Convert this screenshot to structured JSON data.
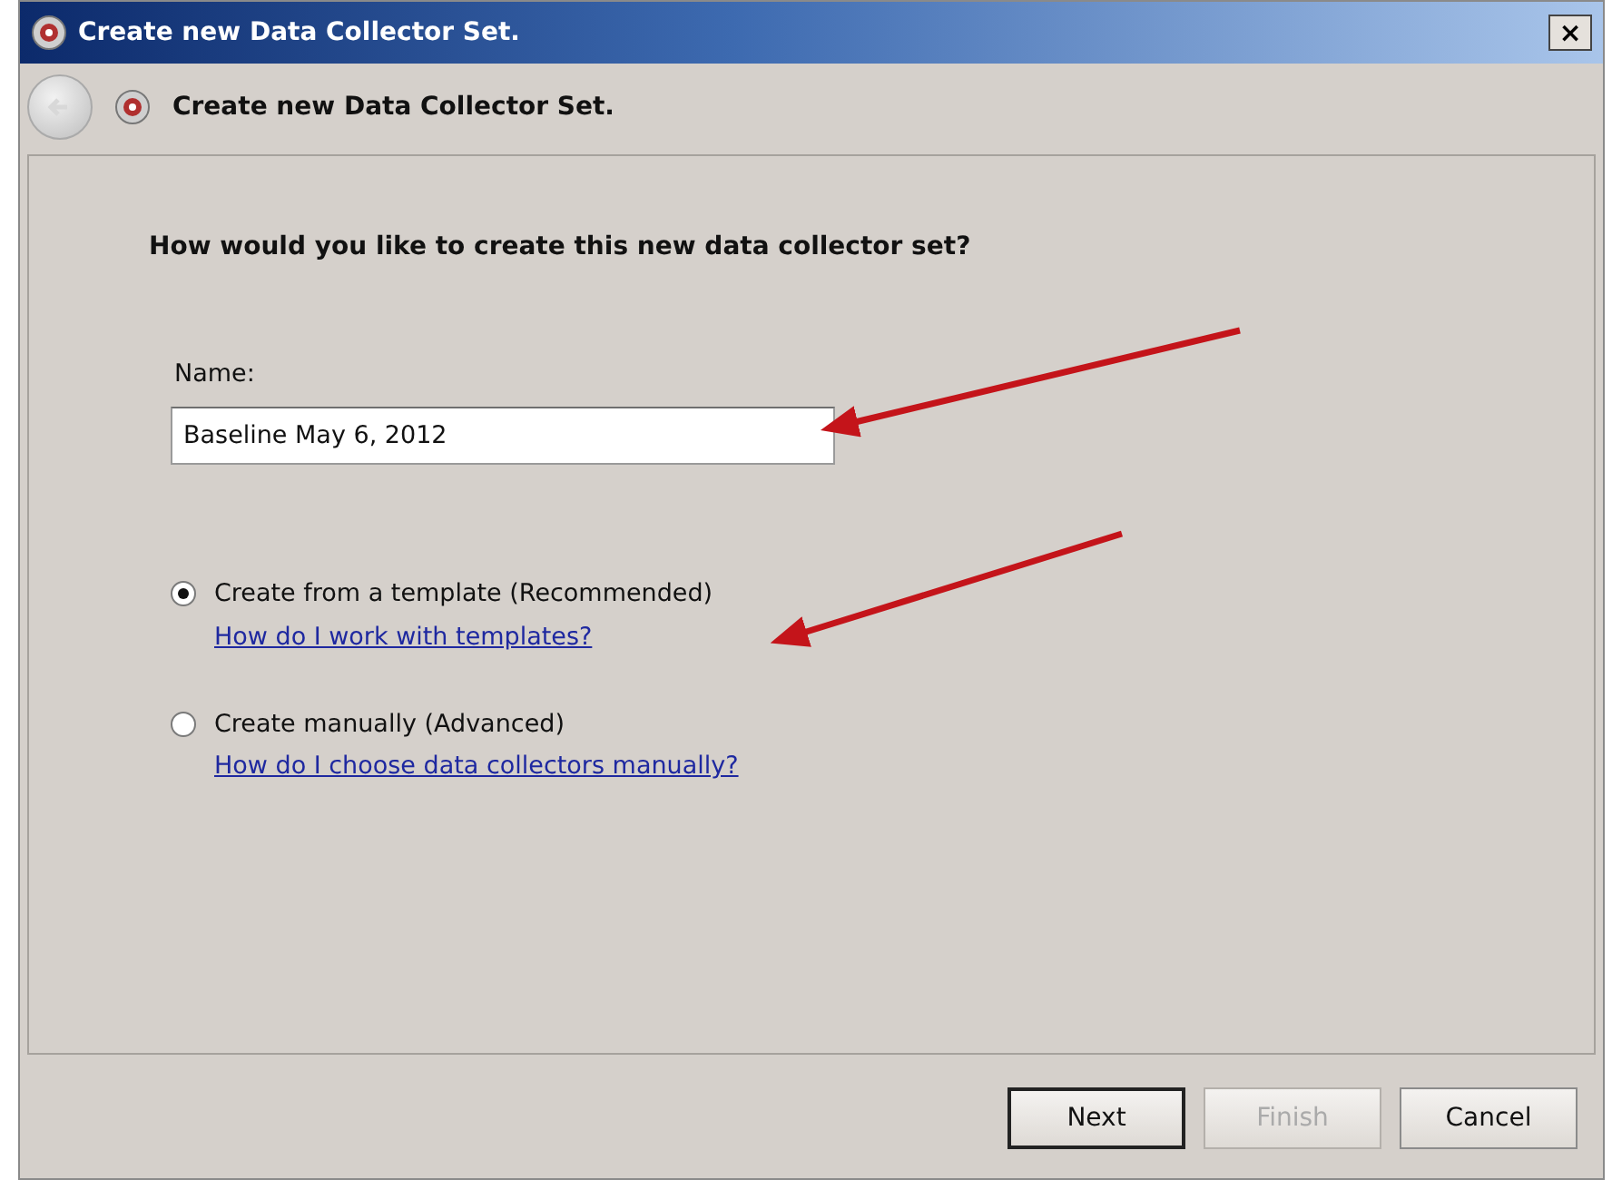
{
  "window": {
    "title": "Create new Data Collector Set.",
    "close": "×"
  },
  "header": {
    "title": "Create new Data Collector Set."
  },
  "question": "How would you like to create this new data collector set?",
  "name_field": {
    "label": "Name:",
    "value": "Baseline May 6, 2012"
  },
  "options": [
    {
      "label": "Create from a template (Recommended)",
      "link": "How do I work with templates?",
      "selected": true
    },
    {
      "label": "Create manually (Advanced)",
      "link": "How do I choose data collectors manually?",
      "selected": false
    }
  ],
  "buttons": [
    {
      "label": "Next",
      "default": true,
      "disabled": false
    },
    {
      "label": "Finish",
      "default": false,
      "disabled": true
    },
    {
      "label": "Cancel",
      "default": false,
      "disabled": false
    }
  ]
}
